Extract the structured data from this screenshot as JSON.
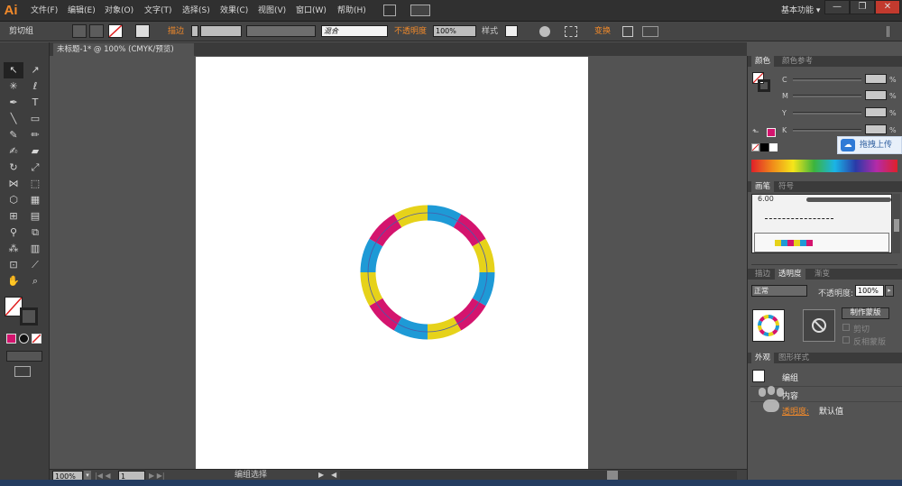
{
  "app": {
    "logo": "Ai"
  },
  "menu": [
    "文件(F)",
    "编辑(E)",
    "对象(O)",
    "文字(T)",
    "选择(S)",
    "效果(C)",
    "视图(V)",
    "窗口(W)",
    "帮助(H)"
  ],
  "workspace": {
    "label": "基本功能 ▾",
    "search_icon": "search-icon"
  },
  "window_controls": [
    "—",
    "❐",
    "✕"
  ],
  "control_bar": {
    "selection_label": "剪切组",
    "stroke_label": "描边",
    "blend_value": "混合",
    "opacity_label": "不透明度",
    "opacity_value": "100%",
    "style_label": "样式",
    "transform_label": "变换"
  },
  "document": {
    "tab_title": "未标题-1* @ 100% (CMYK/预览)"
  },
  "status": {
    "zoom": "100%",
    "page": "1",
    "tool": "编组选择"
  },
  "tools": [
    [
      "selection-tool",
      "↖"
    ],
    [
      "direct-selection-tool",
      "↗"
    ],
    [
      "magic-wand-tool",
      "✳"
    ],
    [
      "lasso-tool",
      "ℓ"
    ],
    [
      "pen-tool",
      "✒"
    ],
    [
      "type-tool",
      "T"
    ],
    [
      "line-tool",
      "╲"
    ],
    [
      "rectangle-tool",
      "▭"
    ],
    [
      "paintbrush-tool",
      "✎"
    ],
    [
      "pencil-tool",
      "✏"
    ],
    [
      "blob-brush-tool",
      "✍"
    ],
    [
      "eraser-tool",
      "▰"
    ],
    [
      "rotate-tool",
      "↻"
    ],
    [
      "scale-tool",
      "⤢"
    ],
    [
      "width-tool",
      "⋈"
    ],
    [
      "free-transform-tool",
      "⬚"
    ],
    [
      "shape-builder-tool",
      "⬡"
    ],
    [
      "perspective-grid-tool",
      "▦"
    ],
    [
      "mesh-tool",
      "⊞"
    ],
    [
      "gradient-tool",
      "▤"
    ],
    [
      "eyedropper-tool",
      "⚲"
    ],
    [
      "blend-tool",
      "⧉"
    ],
    [
      "symbol-sprayer-tool",
      "⁂"
    ],
    [
      "column-graph-tool",
      "▥"
    ],
    [
      "artboard-tool",
      "⊡"
    ],
    [
      "slice-tool",
      "⟋"
    ],
    [
      "hand-tool",
      "✋"
    ],
    [
      "zoom-tool",
      "⌕"
    ]
  ],
  "colors": {
    "accent_orange": "#f28a2a",
    "fill_magenta": "#d4146e",
    "ring_cyan": "#1e9ad6",
    "ring_magenta": "#d4146e",
    "ring_yellow": "#e6d21a"
  },
  "color_panel": {
    "tabs": [
      "颜色",
      "颜色参考"
    ],
    "channels": [
      {
        "label": "C",
        "unit": "%"
      },
      {
        "label": "M",
        "unit": "%"
      },
      {
        "label": "Y",
        "unit": "%"
      },
      {
        "label": "K",
        "unit": "%"
      }
    ]
  },
  "cloud_upload": {
    "label": "拖拽上传"
  },
  "brush_panel": {
    "tabs": [
      "画笔",
      "符号"
    ],
    "brush_size": "6.00"
  },
  "transparency_panel": {
    "tabs": [
      "描边",
      "透明度",
      "渐变"
    ],
    "mode": "正常",
    "opacity_label": "不透明度:",
    "opacity_value": "100%",
    "make_mask_label": "制作蒙版",
    "clip_label": "剪切",
    "invert_label": "反相蒙版"
  },
  "appearance_panel": {
    "tabs": [
      "外观",
      "图形样式"
    ],
    "group_label": "编组",
    "contents_label": "内容",
    "opacity_row_label": "透明度:",
    "opacity_row_value": "默认值"
  }
}
